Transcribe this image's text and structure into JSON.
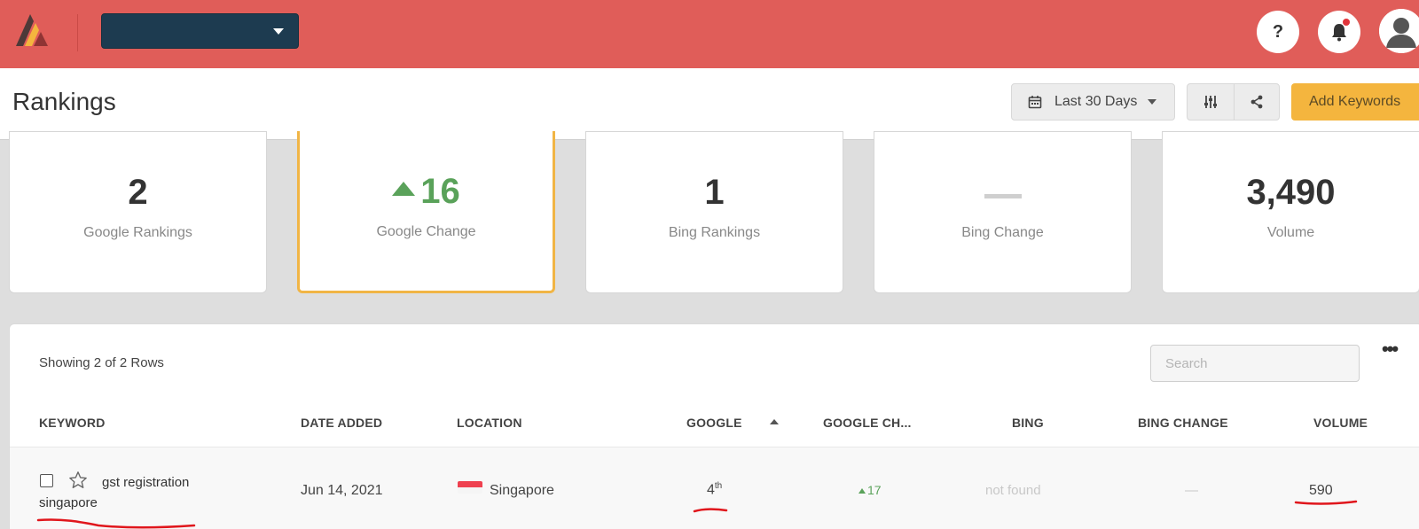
{
  "colors": {
    "topbar": "#e05d59",
    "accent": "#f4b53e",
    "positive": "#5aa25a",
    "account_select": "#1d3b50"
  },
  "topbar": {
    "logo_icon": "triangle-logo",
    "account_select_icon": "caret-down-icon",
    "help_label": "?",
    "notifications_icon": "bell-icon",
    "avatar_icon": "user-avatar-icon"
  },
  "header": {
    "title": "Rankings",
    "date_range_label": "Last 30 Days",
    "date_icon": "calendar-icon",
    "settings_icon": "sliders-icon",
    "share_icon": "share-icon",
    "add_keywords_label": "Add Keywords"
  },
  "stats": [
    {
      "value": "2",
      "label": "Google Rankings"
    },
    {
      "value": "16",
      "label": "Google Change",
      "trend": "up"
    },
    {
      "value": "1",
      "label": "Bing Rankings"
    },
    {
      "value": "—",
      "label": "Bing Change"
    },
    {
      "value": "3,490",
      "label": "Volume"
    }
  ],
  "table": {
    "rows_info": "Showing 2 of 2 Rows",
    "search_placeholder": "Search",
    "more_label": "•••",
    "columns": [
      "KEYWORD",
      "DATE ADDED",
      "LOCATION",
      "GOOGLE",
      "GOOGLE CH...",
      "BING",
      "BING CHANGE",
      "VOLUME"
    ],
    "rows": [
      {
        "keyword": "gst registration singapore",
        "date_added": "Jun 14, 2021",
        "location": "Singapore",
        "google_rank": "4",
        "google_rank_suffix": "th",
        "google_change": "17",
        "bing": "not found",
        "bing_change": "—",
        "volume": "590"
      }
    ]
  }
}
